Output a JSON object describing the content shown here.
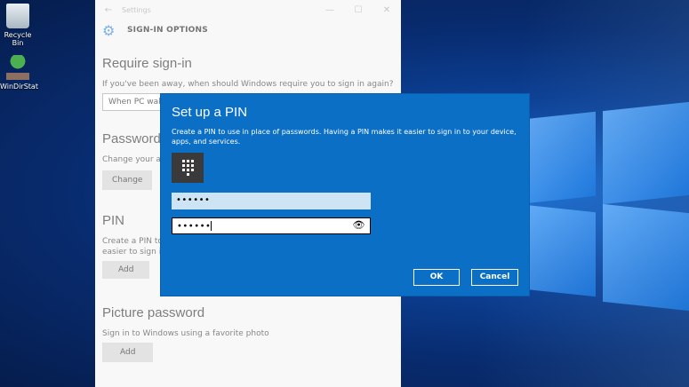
{
  "desktop": {
    "icons": [
      {
        "label": "Recycle Bin"
      },
      {
        "label": "WinDirStat"
      }
    ]
  },
  "settings": {
    "window_title": "Settings",
    "back_glyph": "←",
    "min_glyph": "—",
    "max_glyph": "☐",
    "close_glyph": "✕",
    "header": "SIGN-IN OPTIONS",
    "require": {
      "title": "Require sign-in",
      "text": "If you've been away, when should Windows require you to sign in again?",
      "select_value": "When PC wake"
    },
    "password": {
      "title": "Password",
      "text": "Change your acc",
      "button": "Change"
    },
    "pin": {
      "title": "PIN",
      "text_line1": "Create a PIN to",
      "text_line2": "easier to sign in",
      "button": "Add"
    },
    "picture": {
      "title": "Picture password",
      "text": "Sign in to Windows using a favorite photo",
      "button": "Add"
    }
  },
  "dialog": {
    "title": "Set up a PIN",
    "description": "Create a PIN to use in place of passwords. Having a PIN makes it easier to sign in to your device, apps, and services.",
    "new_pin_value": "••••••",
    "confirm_pin_value": "••••••",
    "ok_label": "OK",
    "cancel_label": "Cancel"
  },
  "colors": {
    "dialog_bg": "#0b6fc6",
    "accent": "#1570d6"
  }
}
